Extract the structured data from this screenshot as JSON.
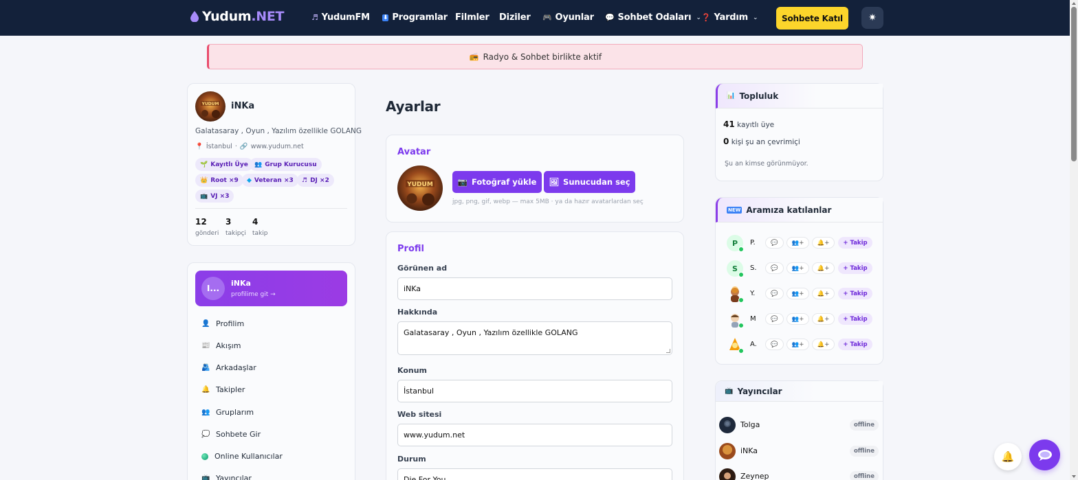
{
  "nav": {
    "logo_main": "Yudum",
    "logo_ext": ".NET",
    "items": [
      {
        "label": "YudumFM",
        "icon": "music-note-icon",
        "glyph": "♬"
      },
      {
        "label": "Programlar",
        "icon": "download-icon",
        "glyph": "⬇"
      },
      {
        "label": "Filmler"
      },
      {
        "label": "Diziler"
      },
      {
        "label": "Oyunlar",
        "icon": "gamepad-icon",
        "glyph": "🎮"
      },
      {
        "label": "Sohbet Odaları",
        "icon": "speech-bubble-icon",
        "glyph": "💬"
      },
      {
        "label": "Yardım",
        "icon": "question-icon",
        "glyph": "❓"
      }
    ],
    "join_label": "Sohbete Katıl",
    "theme_glyph": "✷"
  },
  "banner": {
    "icon": "radio-icon",
    "glyph": "📻",
    "text": "Radyo & Sohbet birlikte aktif"
  },
  "profile": {
    "name": "iNKa",
    "bio": "Galatasaray , Oyun , Yazılım özellikle GOLANG",
    "location": "İstanbul",
    "website": "www.yudum.net",
    "badges": [
      "Kayıtlı Üye",
      "Grup Kurucusu",
      "Root ×9",
      "Veteran ×3",
      "DJ ×2",
      "VJ ×3"
    ],
    "stats": [
      {
        "value": "12",
        "label": "gönderi"
      },
      {
        "value": "3",
        "label": "takipçi"
      },
      {
        "value": "4",
        "label": "takip"
      }
    ]
  },
  "menu": {
    "avatar_text": "I...",
    "name": "iNKa",
    "sub": "profilime git →",
    "items": [
      "Profilim",
      "Akışım",
      "Arkadaşlar",
      "Takipler",
      "Gruplarım",
      "Sohbete Gir",
      "Online Kullanıcılar",
      "Yayıncılar"
    ]
  },
  "settings": {
    "title": "Ayarlar",
    "avatar_section": "Avatar",
    "upload_label": "Fotoğraf yükle",
    "server_label": "Sunucudan seç",
    "hint": "jpg, png, gif, webp — max 5MB · ya da hazır avatarlardan seç",
    "profile_section": "Profil",
    "fields": {
      "display_name_label": "Görünen ad",
      "display_name": "iNKa",
      "about_label": "Hakkında",
      "about": "Galatasaray , Oyun , Yazılım özellikle GOLANG",
      "location_label": "Konum",
      "location": "İstanbul",
      "website_label": "Web sitesi",
      "website": "www.yudum.net",
      "status_label": "Durum",
      "status": "Die For You"
    }
  },
  "community": {
    "title": "Topluluk",
    "registered_count": "41",
    "registered_label": "kayıtlı üye",
    "online_count": "0",
    "online_label": "kişi şu an çevrimiçi",
    "note": "Şu an kimse görünmüyor."
  },
  "newcomers": {
    "title": "Aramıza katılanlar",
    "follow_label": "+ Takip",
    "chat_glyph": "💬",
    "friend_label": "👥+",
    "bell_label": "🔔+",
    "users": [
      {
        "initial": "P",
        "name": "P."
      },
      {
        "initial": "S",
        "name": "S."
      },
      {
        "initial": "",
        "name": "Y."
      },
      {
        "initial": "",
        "name": "M"
      },
      {
        "initial": "",
        "name": "A."
      }
    ]
  },
  "streamers": {
    "title": "Yayıncılar",
    "offline_label": "offline",
    "users": [
      {
        "name": "Tolga"
      },
      {
        "name": "iNKa"
      },
      {
        "name": "Zeynep"
      }
    ]
  },
  "colors": {
    "nav_bg": "#13213a",
    "accent": "#7c3aed",
    "join_btn": "#fcd52b",
    "online": "#22c55e"
  }
}
